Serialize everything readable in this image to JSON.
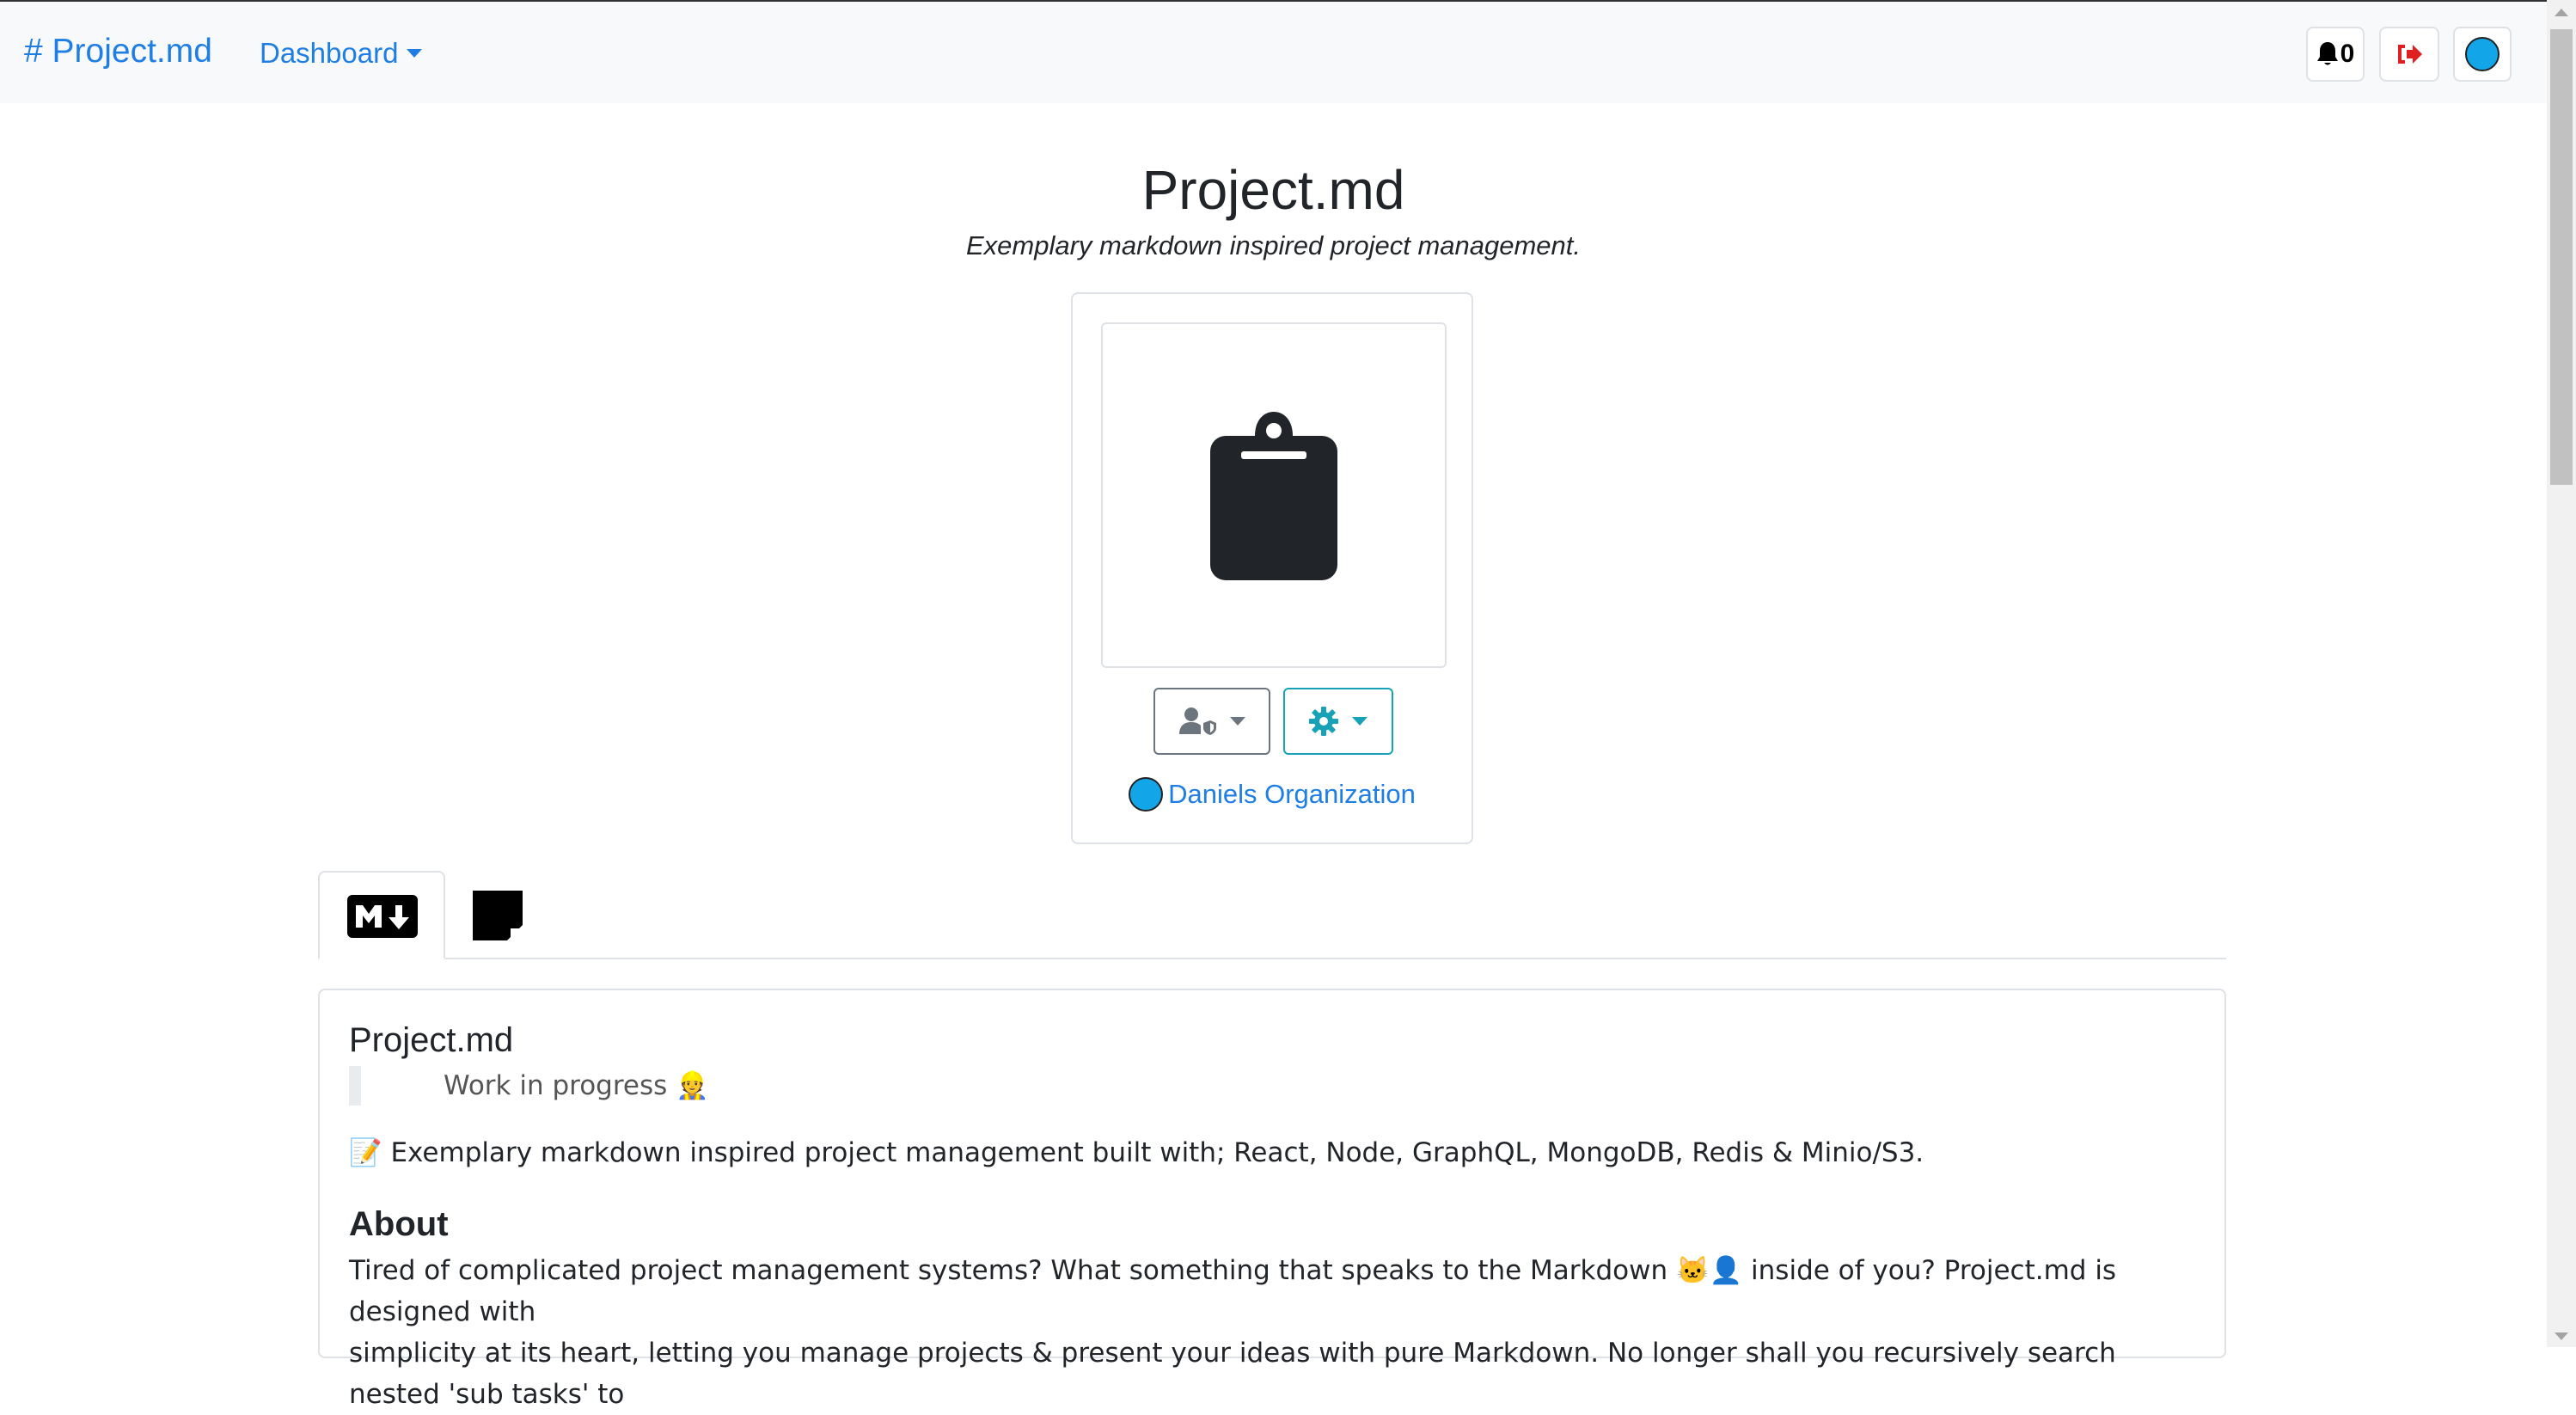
{
  "navbar": {
    "brand": "# Project.md",
    "dashboard_label": "Dashboard",
    "notification_count": "0"
  },
  "hero": {
    "title": "Project.md",
    "subtitle": "Exemplary markdown inspired project management."
  },
  "project_card": {
    "image_icon": "clipboard-icon",
    "permissions_icon": "user-shield-icon",
    "settings_icon": "gear-icon",
    "organization": "Daniels Organization"
  },
  "tabs": [
    {
      "name": "markdown-tab",
      "icon": "markdown-icon"
    },
    {
      "name": "notes-tab",
      "icon": "sticky-note-icon"
    }
  ],
  "readme": {
    "h1": "Project.md",
    "quote": "Work in progress 👷",
    "intro": "📝 Exemplary markdown inspired project management built with; React, Node, GraphQL, MongoDB, Redis & Minio/S3.",
    "h2": "About",
    "about_line1": "Tired of complicated project management systems? What something that speaks to the Markdown 🐱‍👤 inside of you? Project.md is designed with",
    "about_line2": "simplicity at its heart, letting you manage projects & present your ideas with pure Markdown. No longer shall you recursively search nested 'sub tasks' to"
  },
  "colors": {
    "link": "#1e7ee3",
    "avatar": "#12a6e8",
    "teal": "#17a2b8",
    "logout": "#e02020"
  }
}
